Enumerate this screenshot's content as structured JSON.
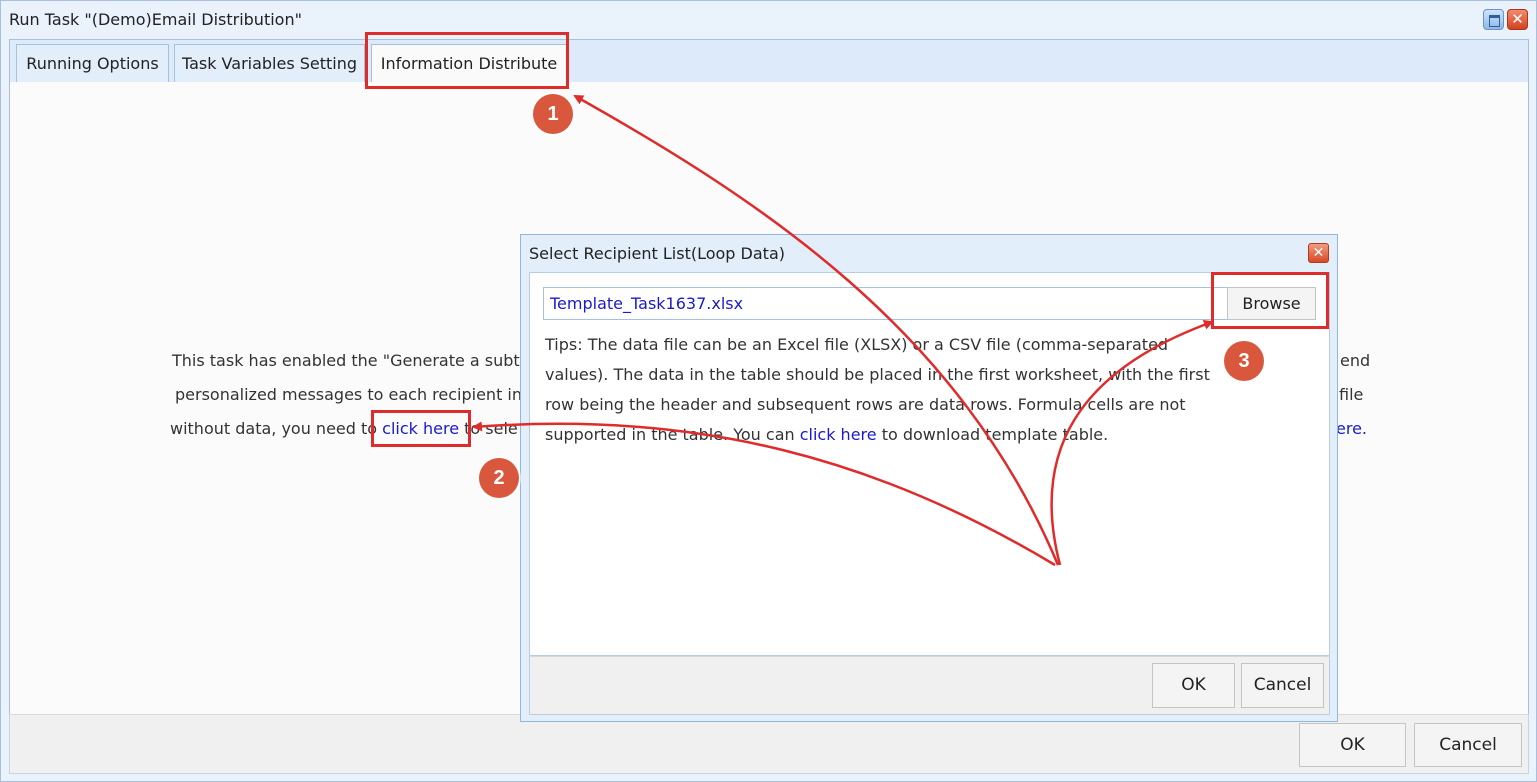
{
  "window": {
    "title": "Run Task \"(Demo)Email Distribution\"",
    "close_glyph": "✕",
    "tabs": [
      {
        "label": "Running Options"
      },
      {
        "label": "Task Variables Setting"
      },
      {
        "label": "Information Distribute"
      }
    ],
    "info": {
      "line1_left": "This task has enabled the \"Generate a subta",
      "line1_right": "end",
      "line2_left": "personalized messages to each recipient in",
      "line2_right": "file",
      "line3_prefix": "without data, you need to ",
      "line3_link": "click here",
      "line3_suffix": " to sele",
      "line3_right": "ere."
    },
    "ok_label": "OK",
    "cancel_label": "Cancel"
  },
  "dialog": {
    "title": "Select Recipient List(Loop Data)",
    "close_glyph": "✕",
    "file_value": "Template_Task1637.xlsx",
    "browse_label": "Browse",
    "tips_prefix": "Tips: The data file can be an Excel file (XLSX) or a CSV file (comma-separated values). The data in the table should be placed in the first worksheet, with the first row being the header and subsequent rows are data rows. Formula cells are not supported in the table. You can ",
    "tips_link": "click here",
    "tips_suffix": " to download template table.",
    "ok_label": "OK",
    "cancel_label": "Cancel"
  },
  "annotations": {
    "badges": [
      "1",
      "2",
      "3"
    ],
    "color": "#e02b2b",
    "badge_color": "#d9573d"
  }
}
